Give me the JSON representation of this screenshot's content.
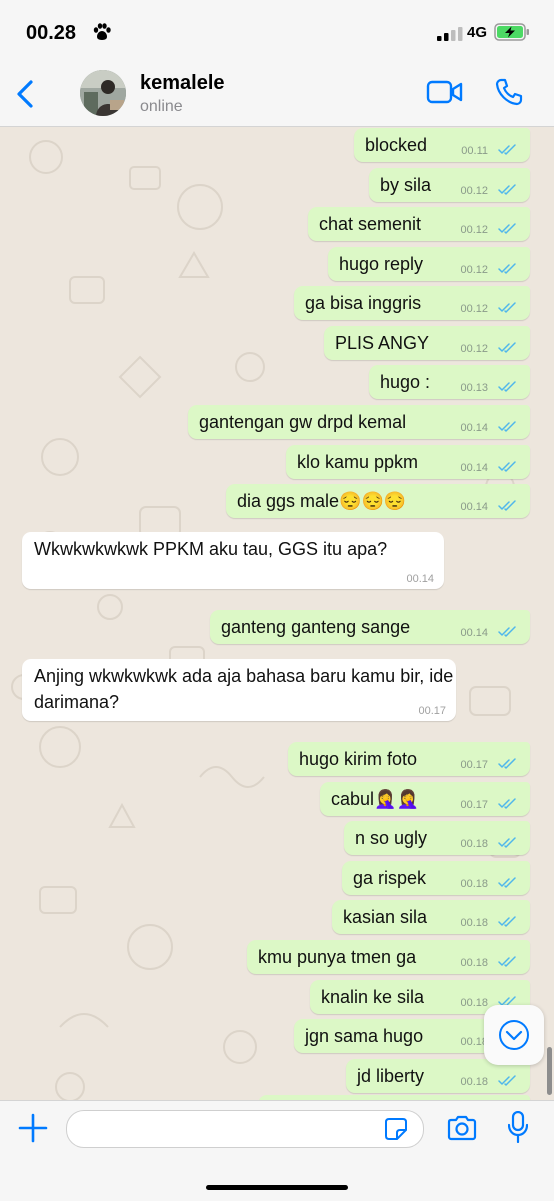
{
  "status_bar": {
    "time": "00.28",
    "network": "4G",
    "status_icon": "paw-icon"
  },
  "header": {
    "contact_name": "kemalele",
    "contact_status": "online"
  },
  "colors": {
    "accent": "#007aff",
    "outgoing_bubble": "#dcf8c6",
    "incoming_bubble": "#ffffff",
    "read_tick": "#4fb6ec",
    "battery": "#4cd964"
  },
  "messages": [
    {
      "text": "blocked",
      "time": "00.11",
      "dir": "out"
    },
    {
      "text": "by sila",
      "time": "00.12",
      "dir": "out"
    },
    {
      "text": "chat semenit",
      "time": "00.12",
      "dir": "out"
    },
    {
      "text": "hugo reply",
      "time": "00.12",
      "dir": "out"
    },
    {
      "text": "ga bisa inggris",
      "time": "00.12",
      "dir": "out"
    },
    {
      "text": "PLIS ANGY",
      "time": "00.12",
      "dir": "out"
    },
    {
      "text": "hugo :",
      "time": "00.13",
      "dir": "out"
    },
    {
      "text": "gantengan gw drpd kemal",
      "time": "00.14",
      "dir": "out"
    },
    {
      "text": "klo kamu ppkm",
      "time": "00.14",
      "dir": "out"
    },
    {
      "text": "dia ggs male😔😔😔",
      "time": "00.14",
      "dir": "out"
    },
    {
      "text": "Wkwkwkwkwk PPKM aku tau, GGS itu apa?",
      "time": "00.14",
      "dir": "in"
    },
    {
      "text": "ganteng ganteng sange",
      "time": "00.14",
      "dir": "out"
    },
    {
      "text": "Anjing wkwkwkwk ada aja bahasa baru kamu bir, ide darimana?",
      "time": "00.17",
      "dir": "in"
    },
    {
      "text": "hugo kirim foto",
      "time": "00.17",
      "dir": "out"
    },
    {
      "text": "cabul🤦‍♀️🤦‍♀️",
      "time": "00.17",
      "dir": "out"
    },
    {
      "text": "n so ugly",
      "time": "00.18",
      "dir": "out"
    },
    {
      "text": "ga rispek",
      "time": "00.18",
      "dir": "out"
    },
    {
      "text": "kasian sila",
      "time": "00.18",
      "dir": "out"
    },
    {
      "text": "kmu punya tmen ga",
      "time": "00.18",
      "dir": "out"
    },
    {
      "text": "knalin ke sila",
      "time": "00.18",
      "dir": "out"
    },
    {
      "text": "jgn sama hugo",
      "time": "00.18",
      "dir": "out"
    },
    {
      "text": "jd liberty",
      "time": "00.18",
      "dir": "out"
    }
  ],
  "input": {
    "placeholder": ""
  }
}
